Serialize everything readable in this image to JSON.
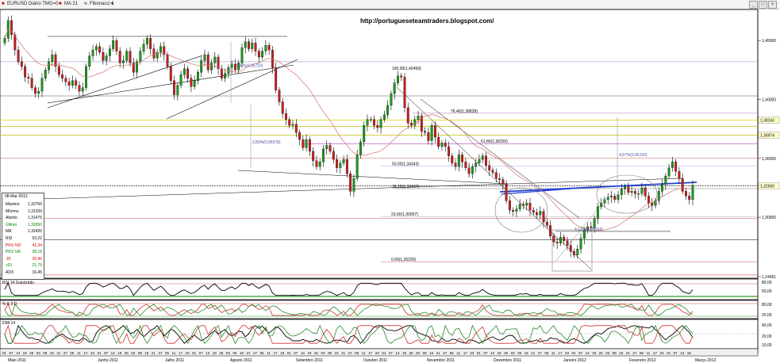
{
  "toolbar": {
    "symbol_label": "EURUSD Diário TMG=0",
    "ma_label": "MA 21",
    "fib_label": "Fibonacci 1",
    "close_glyph": "×",
    "min_glyph": "_",
    "max_glyph": "□"
  },
  "blog_url": "http://portugueseteamtraders.blogspot.com/",
  "fib_labels": [
    {
      "text": "100,00(1,42459)",
      "price": 1.4246
    },
    {
      "text": "76,40(1,38828)",
      "price": 1.3883
    },
    {
      "text": "61,80(1,36250)",
      "price": 1.3625
    },
    {
      "text": "50,00(1,34343)",
      "price": 1.3434
    },
    {
      "text": "38,20(1,32427)",
      "price": 1.3243
    },
    {
      "text": "23,60(1,30057)",
      "price": 1.3006
    },
    {
      "text": "0,00(1,26226)",
      "price": 1.2623
    }
  ],
  "annotations": [
    {
      "text": "3,86%(0,05723)",
      "price": 1.4275
    },
    {
      "text": "3,89%(0,05578)",
      "price": 1.3625
    },
    {
      "text": "4,67%(0,06193)",
      "price": 1.352
    },
    {
      "text": "4,12%(0,05564)",
      "price": 1.2885
    }
  ],
  "price_axis": {
    "ticks": [
      "1,45000",
      "1,40000",
      "1,35000",
      "1,30000",
      "1,24961"
    ],
    "boxes": [
      {
        "text": "1,38243",
        "color": "#ffffcc"
      },
      {
        "text": "1,36974",
        "color": "#ffffcc"
      },
      {
        "text": "1,32650",
        "color": "#ffffcc"
      }
    ]
  },
  "info_panel": {
    "date": "08-Mar-2012",
    "rows": [
      {
        "k": "Máximo",
        "v": "1,32766",
        "color": "#000000"
      },
      {
        "k": "Mínimo",
        "v": "1,31339",
        "color": "#000000"
      },
      {
        "k": "Aberto",
        "v": "1,31476",
        "color": "#000000"
      },
      {
        "k": "Último",
        "v": "1,32650",
        "color": "#008000"
      },
      {
        "k": "MA",
        "v": "1,32420",
        "color": "#000000"
      },
      {
        "k": "RSI",
        "v": "53,22",
        "color": "#000000"
      },
      {
        "k": "PKS %D",
        "v": "41,34",
        "color": "#d00000"
      },
      {
        "k": "PKS %K",
        "v": "28,16",
        "color": "#008000"
      },
      {
        "k": "-DI",
        "v": "20,46",
        "color": "#d00000"
      },
      {
        "k": "+DI",
        "v": "21,75",
        "color": "#008000"
      },
      {
        "k": "ADX",
        "v": "16,45",
        "color": "#000000"
      }
    ]
  },
  "indicators": {
    "rsi": {
      "label": "RSI 14 Suavizado",
      "ticks": [
        "80,00",
        "50,00"
      ]
    },
    "stoch": {
      "label": "% K 3 D",
      "ticks": [
        "80,00",
        "20,00"
      ]
    },
    "dmi": {
      "label": "DMI 14",
      "ticks": [
        "40,00",
        "20,00",
        "10,00"
      ]
    }
  },
  "time_axis": {
    "months": [
      "Maio 2011",
      "Junho 2011",
      "Julho 2011",
      "Agosto 2011",
      "Setembro 2011",
      "Outubro 2011",
      "Novembro 2011",
      "Dezembro 2011",
      "Janeiro 2012",
      "Fevereiro 2012",
      "Março 2012"
    ]
  },
  "chart_data": {
    "type": "candlestick",
    "title": "EURUSD Diário TMG=0",
    "xlabel": "",
    "ylabel": "",
    "ylim": [
      1.2496,
      1.475
    ],
    "grid": false,
    "series": [
      {
        "name": "EURUSD",
        "values": [
          1.452,
          1.467,
          1.455,
          1.442,
          1.432,
          1.428,
          1.419,
          1.418,
          1.41,
          1.405,
          1.407,
          1.418,
          1.425,
          1.432,
          1.438,
          1.428,
          1.421,
          1.418,
          1.415,
          1.412,
          1.416,
          1.412,
          1.407,
          1.41,
          1.428,
          1.437,
          1.442,
          1.445,
          1.44,
          1.433,
          1.437,
          1.443,
          1.45,
          1.441,
          1.431,
          1.433,
          1.441,
          1.431,
          1.423,
          1.432,
          1.441,
          1.447,
          1.452,
          1.443,
          1.435,
          1.44,
          1.445,
          1.438,
          1.428,
          1.416,
          1.404,
          1.412,
          1.421,
          1.426,
          1.418,
          1.411,
          1.416,
          1.423,
          1.433,
          1.438,
          1.425,
          1.431,
          1.436,
          1.426,
          1.418,
          1.422,
          1.427,
          1.43,
          1.425,
          1.431,
          1.444,
          1.449,
          1.443,
          1.448,
          1.441,
          1.436,
          1.441,
          1.446,
          1.442,
          1.427,
          1.408,
          1.398,
          1.388,
          1.383,
          1.378,
          1.379,
          1.372,
          1.366,
          1.359,
          1.366,
          1.356,
          1.348,
          1.343,
          1.347,
          1.358,
          1.361,
          1.356,
          1.349,
          1.342,
          1.346,
          1.349,
          1.337,
          1.322,
          1.333,
          1.353,
          1.364,
          1.378,
          1.383,
          1.383,
          1.378,
          1.376,
          1.383,
          1.387,
          1.395,
          1.405,
          1.414,
          1.42,
          1.419,
          1.393,
          1.38,
          1.378,
          1.383,
          1.386,
          1.373,
          1.372,
          1.365,
          1.378,
          1.368,
          1.36,
          1.363,
          1.36,
          1.352,
          1.346,
          1.343,
          1.353,
          1.347,
          1.342,
          1.337,
          1.343,
          1.346,
          1.349,
          1.352,
          1.344,
          1.34,
          1.338,
          1.333,
          1.332,
          1.328,
          1.314,
          1.306,
          1.305,
          1.307,
          1.311,
          1.31,
          1.312,
          1.306,
          1.304,
          1.302,
          1.305,
          1.296,
          1.293,
          1.284,
          1.279,
          1.278,
          1.283,
          1.28,
          1.276,
          1.271,
          1.268,
          1.273,
          1.282,
          1.289,
          1.292,
          1.291,
          1.299,
          1.309,
          1.312,
          1.315,
          1.317,
          1.318,
          1.315,
          1.319,
          1.324,
          1.326,
          1.321,
          1.322,
          1.32,
          1.32,
          1.325,
          1.318,
          1.312,
          1.31,
          1.314,
          1.322,
          1.328,
          1.335,
          1.342,
          1.347,
          1.339,
          1.333,
          1.322,
          1.318,
          1.315,
          1.327
        ]
      },
      {
        "name": "MA 21",
        "values": []
      }
    ]
  }
}
